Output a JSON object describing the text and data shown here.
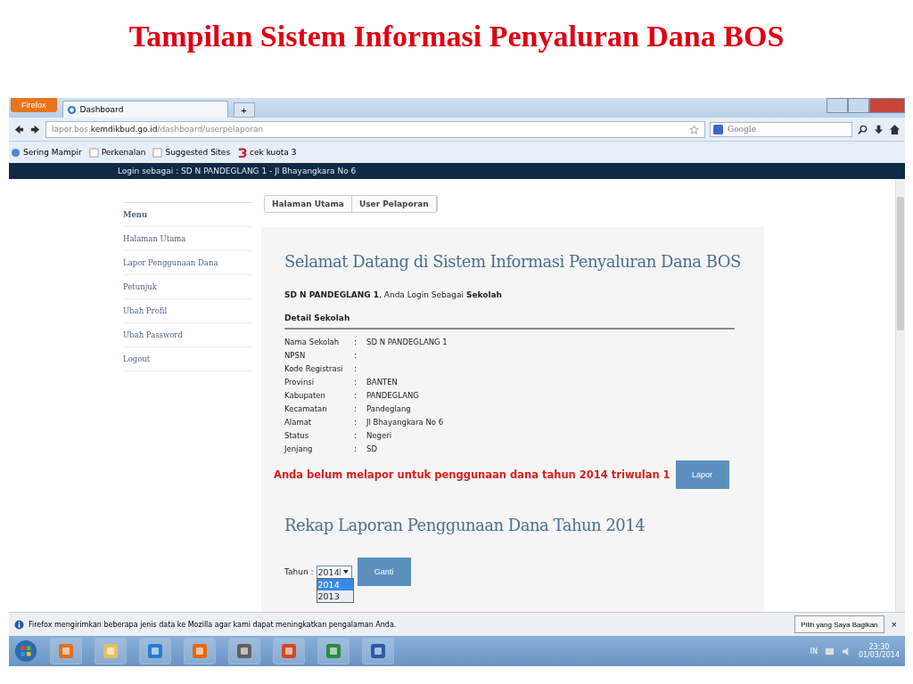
{
  "slide_title": "Tampilan Sistem Informasi Penyaluran Dana BOS",
  "browser": {
    "menu_button": "Firefox",
    "tabs": [
      {
        "label": "Dashboard",
        "selected": true
      }
    ],
    "new_tab": "+",
    "url": {
      "prefix": "lapor.bos.",
      "domain": "kemdikbud.go.id",
      "path": "/dashboard/userpelaporan"
    },
    "search": {
      "placeholder": "Google"
    },
    "bookmarks": [
      {
        "label": "Sering Mampir",
        "kind": "globe"
      },
      {
        "label": "Perkenalan",
        "kind": "page"
      },
      {
        "label": "Suggested Sites",
        "kind": "page"
      },
      {
        "label": "cek kuota 3",
        "kind": "logo"
      }
    ]
  },
  "page": {
    "login_bar": "Login sebagai : SD N PANDEGLANG 1 - Jl Bhayangkara No 6",
    "menu": {
      "title": "Menu",
      "items": [
        "Halaman Utama",
        "Lapor Penggunaan Dana",
        "Petunjuk",
        "Ubah Profil",
        "Ubah Password",
        "Logout"
      ]
    },
    "breadcrumb": [
      "Halaman Utama",
      "User Pelaporan"
    ],
    "heading": "Selamat Datang di Sistem Informasi Penyaluran Dana BOS",
    "welcome": "**SD N PANDEGLANG 1**, Anda Login Sebagai **Sekolah**",
    "detail_title": "Detail Sekolah",
    "details": [
      {
        "label": "Nama Sekolah",
        "value": "SD N PANDEGLANG 1"
      },
      {
        "label": "NPSN"
      },
      {
        "label": "Kode Registrasi"
      },
      {
        "label": "Provinsi",
        "value": "BANTEN"
      },
      {
        "label": "Kabupaten",
        "value": "PANDEGLANG"
      },
      {
        "label": "Kecamatan",
        "value": "Pandeglang"
      },
      {
        "label": "Alamat",
        "value": "Jl Bhayangkara No 6"
      },
      {
        "label": "Status",
        "value": "Negeri"
      },
      {
        "label": "Jenjang",
        "value": "SD"
      }
    ],
    "separator": ":",
    "warning": "Anda belum melapor untuk penggunaan dana tahun 2014 triwulan 1",
    "lapor_button": "Lapor",
    "rekap_heading": "Rekap Laporan Penggunaan Dana Tahun 2014",
    "year_label": "Tahun :",
    "year_select": {
      "value": "2014",
      "expanded": true,
      "options": [
        {
          "label": "2014",
          "selected": true
        },
        {
          "label": "2013",
          "selected": false
        }
      ]
    },
    "ganti_button": "Ganti"
  },
  "notification": {
    "text": "Firefox mengirimkan beberapa jenis data ke Mozilla agar kami dapat meningkatkan pengalaman Anda.",
    "button": "Pilih yang Saya Bagikan",
    "close": "×"
  },
  "taskbar": {
    "apps": [
      {
        "kind": "media"
      },
      {
        "kind": "folder"
      },
      {
        "kind": "ie"
      },
      {
        "kind": "firefox"
      },
      {
        "kind": "app"
      },
      {
        "kind": "ppt"
      },
      {
        "kind": "excel"
      },
      {
        "kind": "word"
      }
    ],
    "language": "IN",
    "time": "23:30",
    "date": "01/03/2014"
  }
}
